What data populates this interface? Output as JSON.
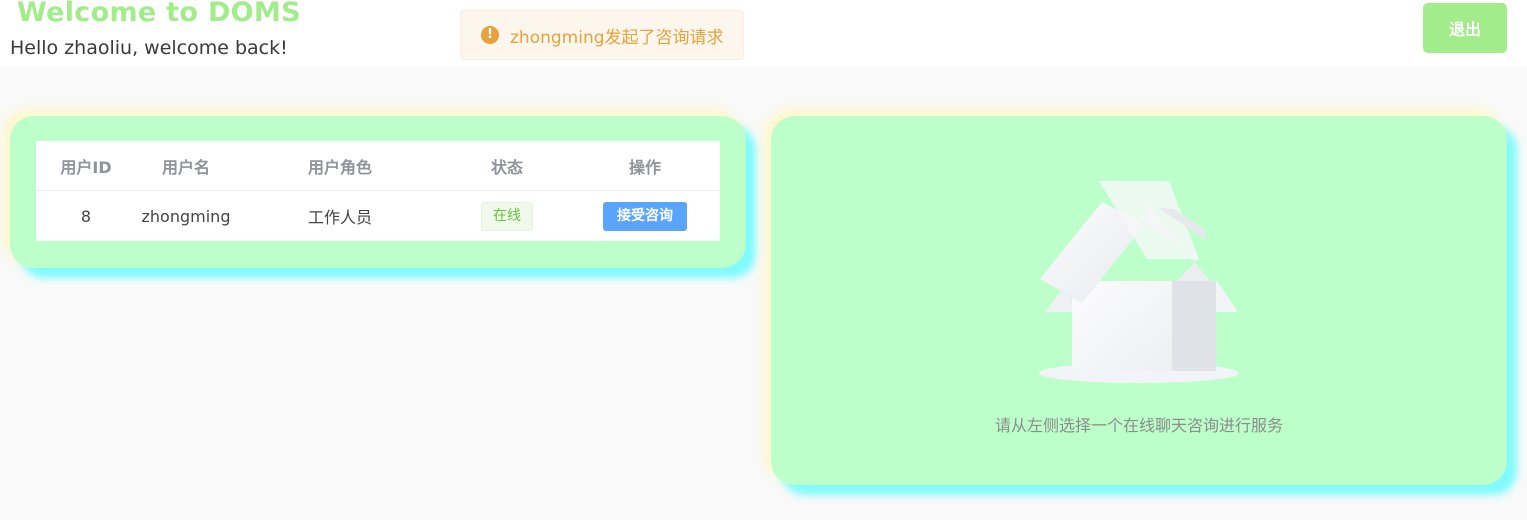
{
  "header": {
    "app_title": "Welcome to DOMS",
    "greeting": "Hello zhaoliu, welcome back!",
    "notification": {
      "icon": "warning-circle-icon",
      "text": "zhongming发起了咨询请求"
    },
    "logout_label": "退出"
  },
  "table": {
    "columns": [
      "用户ID",
      "用户名",
      "用户角色",
      "状态",
      "操作"
    ],
    "rows": [
      {
        "id": "8",
        "username": "zhongming",
        "role": "工作人员",
        "status": "在线",
        "action": "接受咨询"
      }
    ]
  },
  "chat_panel": {
    "empty_icon": "empty-box-icon",
    "empty_text": "请从左侧选择一个在线聊天咨询进行服务"
  },
  "colors": {
    "accent": "#a2ec8c",
    "card_bg": "#bcffca",
    "card_shadow": "#7ffbff",
    "primary_button": "#58a4ff",
    "warning": "#e6a23c"
  }
}
